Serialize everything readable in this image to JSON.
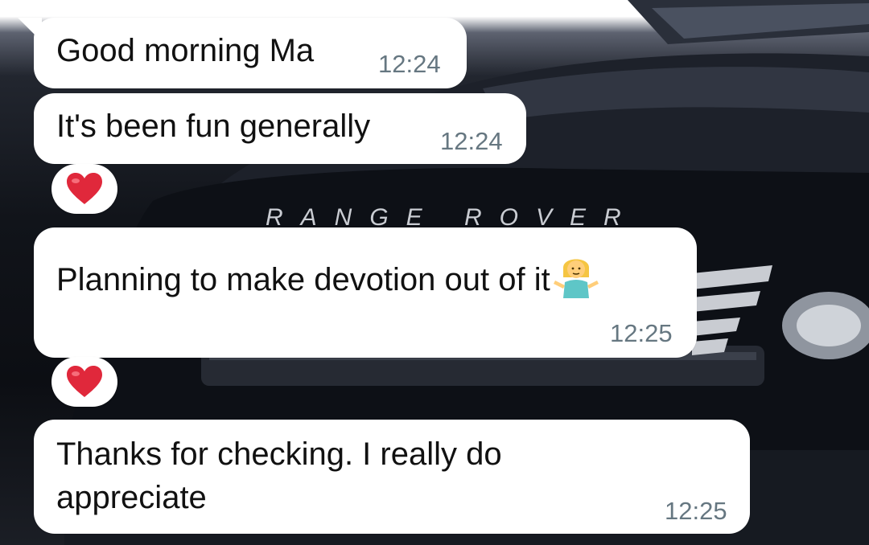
{
  "wallpaper": {
    "badge_text": "RANGE ROVER",
    "description_icon": "car-wallpaper-icon"
  },
  "colors": {
    "bubble": "#ffffff",
    "text": "#111111",
    "timestamp": "#667781",
    "reaction_heart": "#e0283b"
  },
  "messages": [
    {
      "text": "Good morning Ma",
      "time": "12:24"
    },
    {
      "text": "It's been fun generally",
      "time": "12:24",
      "reaction": "heart-icon"
    },
    {
      "text": "Planning to make devotion out of it",
      "emoji": "person-shrugging-icon",
      "time": "12:25",
      "reaction": "heart-icon"
    },
    {
      "text_line1": "Thanks for checking. I really do",
      "text_line2": "appreciate",
      "time": "12:25"
    }
  ]
}
